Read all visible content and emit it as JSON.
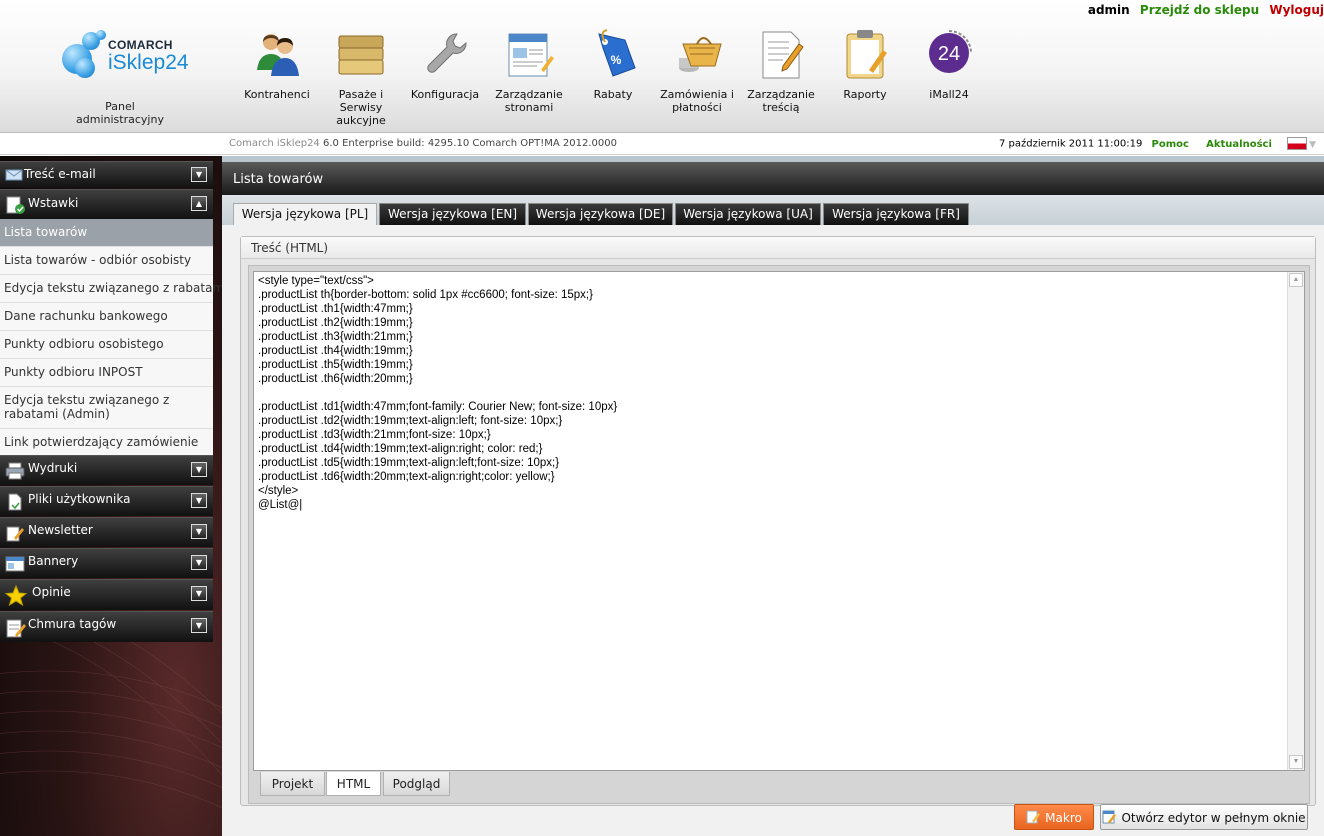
{
  "topbar": {
    "user": "admin",
    "go_to_shop": "Przejdź do sklepu",
    "logout": "Wyloguj"
  },
  "logo": {
    "brand": "COMARCH",
    "product": "iSklep24",
    "panel_label": "Panel administracyjny"
  },
  "nav": [
    {
      "label": "Kontrahenci",
      "icon": "users-icon"
    },
    {
      "label": "Pasaże i Serwisy aukcyjne",
      "icon": "folders-icon"
    },
    {
      "label": "Konfiguracja",
      "icon": "wrench-icon"
    },
    {
      "label": "Zarządzanie stronami",
      "icon": "webpage-icon"
    },
    {
      "label": "Rabaty",
      "icon": "discount-tag-icon"
    },
    {
      "label": "Zamówienia i płatności",
      "icon": "shopping-basket-icon"
    },
    {
      "label": "Zarządzanie treścią",
      "icon": "document-edit-icon"
    },
    {
      "label": "Raporty",
      "icon": "clipboard-icon"
    },
    {
      "label": "iMall24",
      "icon": "imall24-icon"
    }
  ],
  "subheader": {
    "build_prefix": "Comarch iSklep24",
    "build_info": "6.0 Enterprise build: 4295.10  Comarch OPT!MA 2012.0000",
    "date": "7 październik 2011 11:00:19",
    "help": "Pomoc",
    "news": "Aktualności"
  },
  "sidebar": {
    "sections_top": [
      {
        "label": "Treść e-mail",
        "icon": "envelope-icon",
        "toggle": "▼"
      },
      {
        "label": "Wstawki",
        "icon": "insert-icon",
        "toggle": "▲"
      }
    ],
    "items": [
      {
        "label": "Lista towarów",
        "active": true
      },
      {
        "label": "Lista towarów - odbiór osobisty"
      },
      {
        "label": "Edycja tekstu związanego z rabatami"
      },
      {
        "label": "Dane rachunku bankowego"
      },
      {
        "label": "Punkty odbioru osobistego"
      },
      {
        "label": "Punkty odbioru INPOST"
      },
      {
        "label": "Edycja tekstu związanego z rabatami (Admin)"
      },
      {
        "label": "Link potwierdzający zamówienie"
      }
    ],
    "sections_bottom": [
      {
        "label": "Wydruki",
        "icon": "printer-icon",
        "toggle": "▼"
      },
      {
        "label": "Pliki użytkownika",
        "icon": "file-icon",
        "toggle": "▼"
      },
      {
        "label": "Newsletter",
        "icon": "newsletter-icon",
        "toggle": "▼"
      },
      {
        "label": "Bannery",
        "icon": "banner-icon",
        "toggle": "▼"
      },
      {
        "label": "Opinie",
        "icon": "star-icon",
        "toggle": "▼"
      },
      {
        "label": "Chmura tagów",
        "icon": "tag-cloud-icon",
        "toggle": "▼"
      }
    ]
  },
  "main": {
    "title": "Lista towarów",
    "lang_tabs": [
      "Wersja językowa [PL]",
      "Wersja językowa [EN]",
      "Wersja językowa [DE]",
      "Wersja językowa [UA]",
      "Wersja językowa [FR]"
    ],
    "active_lang_tab": 0,
    "panel_title": "Treść (HTML)",
    "code": "<style type=\"text/css\">\n.productList th{border-bottom: solid 1px #cc6600; font-size: 15px;}\n.productList .th1{width:47mm;}\n.productList .th2{width:19mm;}\n.productList .th3{width:21mm;}\n.productList .th4{width:19mm;}\n.productList .th5{width:19mm;}\n.productList .th6{width:20mm;}\n\n.productList .td1{width:47mm;font-family: Courier New; font-size: 10px}\n.productList .td2{width:19mm;text-align:left; font-size: 10px;}\n.productList .td3{width:21mm;font-size: 10px;}\n.productList .td4{width:19mm;text-align:right; color: red;}\n.productList .td5{width:19mm;text-align:left;font-size: 10px;}\n.productList .td6{width:20mm;text-align:right;color: yellow;}\n</style>\n@List@|",
    "mode_tabs": [
      "Projekt",
      "HTML",
      "Podgląd"
    ],
    "active_mode_tab": 1,
    "buttons": {
      "macro": "Makro",
      "fullscreen": "Otwórz edytor w pełnym oknie"
    }
  },
  "colors": {
    "accent_orange": "#e86520",
    "link_green": "#2a8a0a",
    "logout_red": "#c00000",
    "brand_blue": "#1a8ad4"
  }
}
